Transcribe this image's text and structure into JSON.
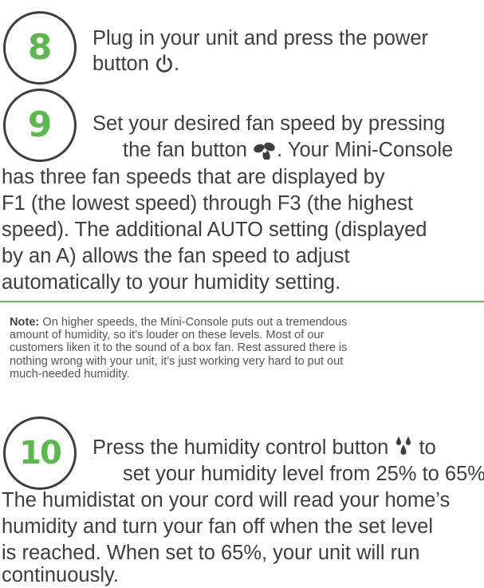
{
  "steps": [
    {
      "number": "8",
      "lines": [
        "Plug in your unit and press the power",
        "button"
      ],
      "suffix": ".",
      "icon": "power-icon"
    },
    {
      "number": "9",
      "lines": [
        "Set your desired fan speed by pressing",
        "the fan button",
        ". Your Mini-Console",
        "has three fan speeds that are displayed by",
        "F1 (the lowest speed) through F3 (the highest",
        "speed). The additional AUTO setting (displayed",
        "by an A) allows the fan speed to adjust",
        "automatically to your humidity setting."
      ],
      "icon": "fan-icon"
    },
    {
      "number": "10",
      "lines": [
        "Press the humidity control button",
        "to",
        "set your humidity level from 25% to 65%.",
        "The humidistat on your cord will read your home’s",
        "humidity and turn your fan off when the set level",
        "is reached. When set to 65%, your unit will run",
        "continuously."
      ],
      "icon": "water-drops-icon"
    }
  ],
  "note": {
    "label": "Note:",
    "lines": [
      "On higher speeds, the Mini-Console puts out a tremendous",
      "amount of humidity, so it’s louder on these levels. Most of our",
      "customers liken it to the sound of a box fan.  Rest assured there is",
      "nothing wrong with your unit, it’s just working very hard to put out",
      "much-needed humidity."
    ]
  },
  "colors": {
    "accent": "#5cb74f",
    "text": "#3e3e3e"
  }
}
